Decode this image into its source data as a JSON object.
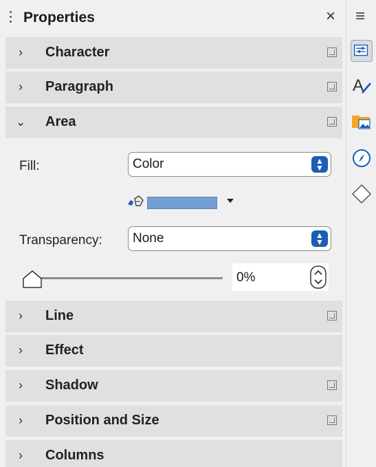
{
  "panel": {
    "title": "Properties",
    "close_glyph": "×"
  },
  "sections": {
    "character": {
      "label": "Character",
      "chevron": "›"
    },
    "paragraph": {
      "label": "Paragraph",
      "chevron": "›"
    },
    "area": {
      "label": "Area",
      "chevron": "⌄"
    },
    "line": {
      "label": "Line",
      "chevron": "›"
    },
    "effect": {
      "label": "Effect",
      "chevron": "›"
    },
    "shadow": {
      "label": "Shadow",
      "chevron": "›"
    },
    "position": {
      "label": "Position and Size",
      "chevron": "›"
    },
    "columns": {
      "label": "Columns",
      "chevron": "›"
    }
  },
  "area": {
    "fill_label": "Fill:",
    "fill_value": "Color",
    "fill_color": "#729fcf",
    "transparency_label": "Transparency:",
    "transparency_value": "None",
    "transparency_percent": "0%"
  },
  "sidebar": {
    "menu_glyph": "≡",
    "tabs": [
      "properties-icon",
      "styles-icon",
      "gallery-icon",
      "navigator-icon",
      "shapes-icon"
    ]
  },
  "colors": {
    "accent": "#1a5fb4",
    "section_bg": "#e0e0e0",
    "panel_bg": "#f0f0f0"
  }
}
